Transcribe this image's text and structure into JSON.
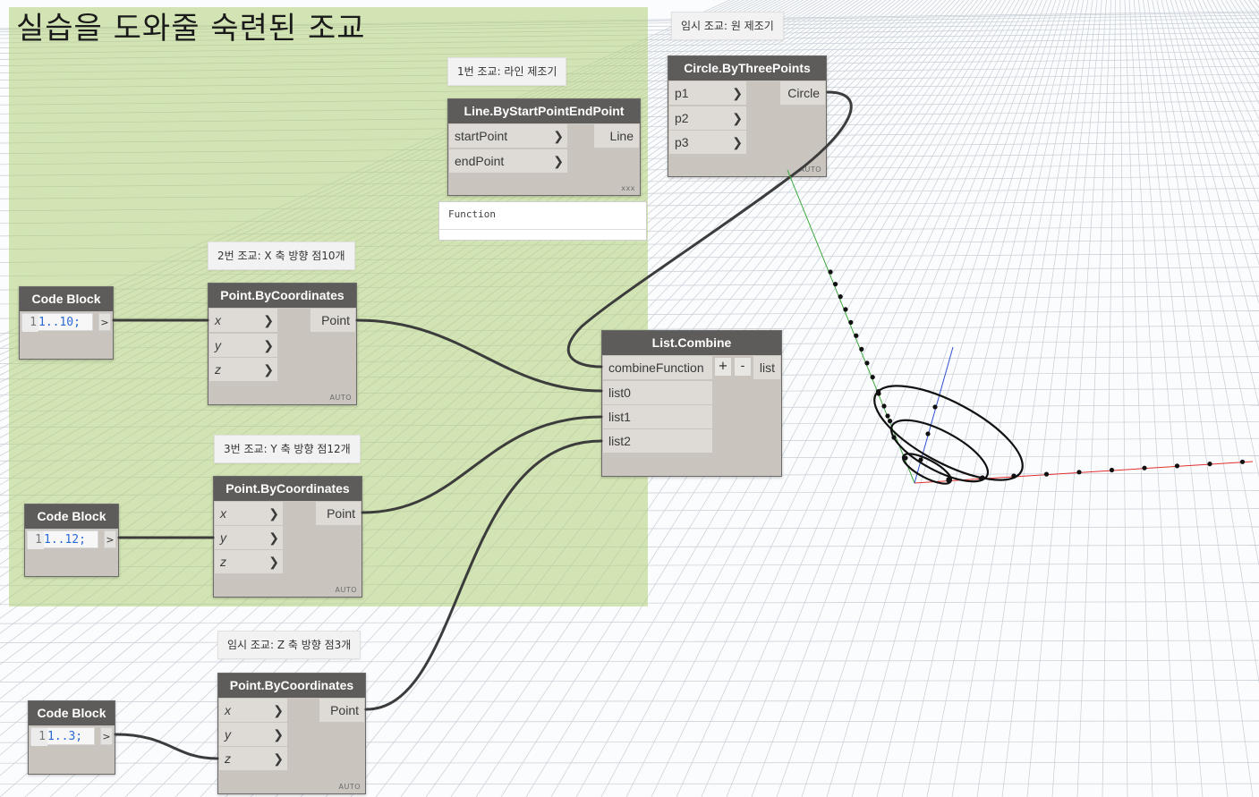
{
  "group": {
    "title": "실습을 도와줄 숙련된 조교"
  },
  "notes": {
    "line_note": "1번 조교: 라인 제조기",
    "circle_note": "임시 조교: 원 제조기",
    "x_note": "2번 조교: X 축 방향 점10개",
    "y_note": "3번 조교: Y 축 방향 점12개",
    "z_note": "임시 조교: Z 축 방향 점3개"
  },
  "nodes": {
    "line": {
      "title": "Line.ByStartPointEndPoint",
      "inputs": [
        "startPoint",
        "endPoint"
      ],
      "output": "Line",
      "lacing": "xxx",
      "function_label": "Function"
    },
    "circle": {
      "title": "Circle.ByThreePoints",
      "inputs": [
        "p1",
        "p2",
        "p3"
      ],
      "output": "Circle",
      "lacing": "AUTO"
    },
    "code1": {
      "title": "Code Block",
      "line_no": "1",
      "code": "1..10;",
      "out": ">"
    },
    "code2": {
      "title": "Code Block",
      "line_no": "1",
      "code": "1..12;",
      "out": ">"
    },
    "code3": {
      "title": "Code Block",
      "line_no": "1",
      "code": "1..3;",
      "out": ">"
    },
    "point1": {
      "title": "Point.ByCoordinates",
      "inputs": [
        "x",
        "y",
        "z"
      ],
      "output": "Point",
      "lacing": "AUTO"
    },
    "point2": {
      "title": "Point.ByCoordinates",
      "inputs": [
        "x",
        "y",
        "z"
      ],
      "output": "Point",
      "lacing": "AUTO"
    },
    "point3": {
      "title": "Point.ByCoordinates",
      "inputs": [
        "x",
        "y",
        "z"
      ],
      "output": "Point",
      "lacing": "AUTO"
    },
    "combine": {
      "title": "List.Combine",
      "inputs": [
        "combineFunction",
        "list0",
        "list1",
        "list2"
      ],
      "add": "+",
      "remove": "-",
      "output": "list"
    }
  },
  "colors": {
    "group": "#b2d078",
    "node_header": "#5e5c5a",
    "node_body": "#c9c5be",
    "x_axis": "#e03030",
    "y_axis": "#3aa83a",
    "z_axis": "#3050d0"
  }
}
